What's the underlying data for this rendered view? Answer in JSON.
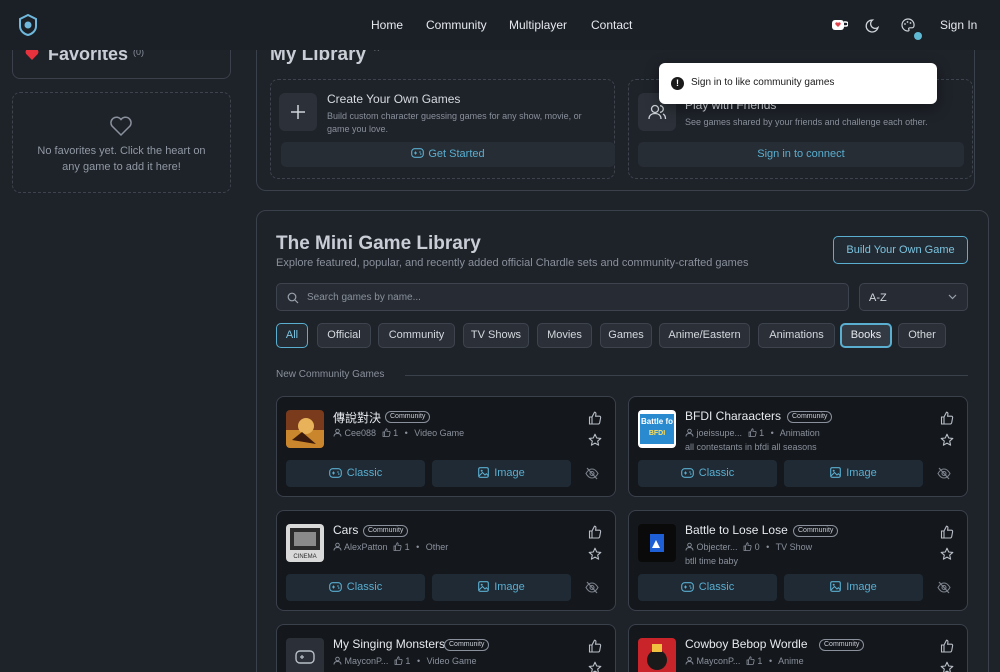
{
  "nav": {
    "links": [
      "Home",
      "Community",
      "Multiplayer",
      "Contact"
    ],
    "sign_in": "Sign In"
  },
  "favorites": {
    "title": "Favorites",
    "count": "(0)",
    "empty_text": "No favorites yet. Click the heart on any game to add it here!"
  },
  "library": {
    "title": "My Library",
    "create": {
      "title": "Create Your Own Games",
      "desc": "Build custom character guessing games for any show, movie, or game you love.",
      "button": "Get Started"
    },
    "friends": {
      "title": "Play with Friends",
      "desc": "See games shared by your friends and challenge each other.",
      "button": "Sign in to connect"
    }
  },
  "toast": {
    "text": "Sign in to like community games"
  },
  "mini": {
    "title": "The Mini Game Library",
    "subtitle": "Explore featured, popular, and recently added official Chardle sets and community-crafted games",
    "build_button": "Build Your Own Game",
    "search_placeholder": "Search games by name...",
    "sort_value": "A-Z",
    "filters": [
      "All",
      "Official",
      "Community",
      "TV Shows",
      "Movies",
      "Games",
      "Anime/Eastern",
      "Animations",
      "Books",
      "Other"
    ],
    "section_label": "New Community Games",
    "badge": "Community",
    "classic_label": "Classic",
    "image_label": "Image",
    "games": [
      {
        "title": "傳說對決",
        "author": "Cee088",
        "likes": "1",
        "category": "Video Game",
        "desc": ""
      },
      {
        "title": "BFDI Charaacters",
        "author": "joeissupe...",
        "likes": "1",
        "category": "Animation",
        "desc": "all contestants in bfdi all seasons"
      },
      {
        "title": "Cars",
        "author": "AlexPatton",
        "likes": "1",
        "category": "Other",
        "desc": ""
      },
      {
        "title": "Battle to Lose Lose",
        "author": "Objecter...",
        "likes": "0",
        "category": "TV Show",
        "desc": "btll time baby"
      },
      {
        "title": "My Singing Monsters",
        "author": "MayconP...",
        "likes": "1",
        "category": "Video Game",
        "desc": ""
      },
      {
        "title": "Cowboy Bebop Wordle",
        "author": "MayconP...",
        "likes": "1",
        "category": "Anime",
        "desc": ""
      }
    ]
  },
  "colors": {
    "accent": "#5aaed0",
    "background": "#1e2229",
    "card": "#14171c"
  }
}
